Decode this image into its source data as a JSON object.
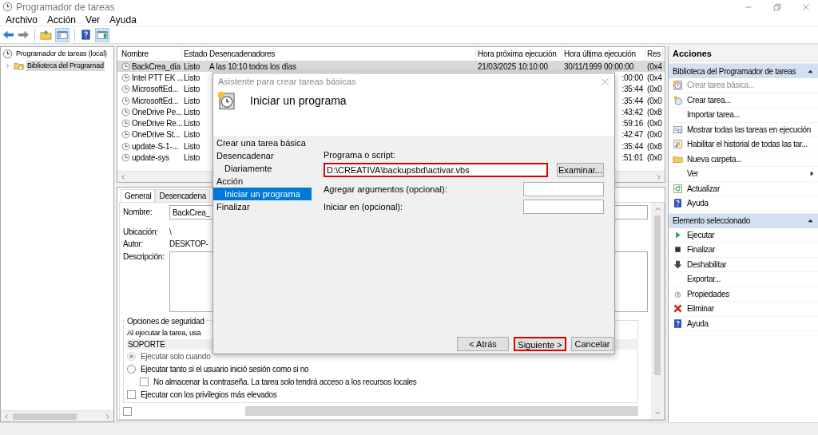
{
  "window": {
    "title": "Programador de tareas"
  },
  "menu": [
    "Archivo",
    "Acción",
    "Ver",
    "Ayuda"
  ],
  "toolbar": {
    "tree_pane_on": true,
    "action_pane_on": true
  },
  "tree": [
    {
      "label": "Programador de tareas (local)",
      "selected": false,
      "children": [
        {
          "label": "Biblioteca del Programad",
          "selected": true,
          "expanded": false
        }
      ]
    }
  ],
  "task_list": {
    "columns": [
      "Nombre",
      "Estado",
      "Desencadenadores",
      "Hora próxima ejecución",
      "Hora última ejecución",
      "Res"
    ],
    "rows": [
      {
        "name": "BackCrea_día",
        "status": "Listo",
        "trigger": "A las 10:10 todos los días",
        "next_run": "21/03/2025 10:10:00",
        "last_run": "30/11/1999 00:00:00",
        "result": "(0x4",
        "selected": true
      },
      {
        "name": "Intel PTT EK ...",
        "status": "Listo",
        "last_run": ":00:00",
        "result": "(0x4",
        "selected": false
      },
      {
        "name": "MicrosoftEd...",
        "status": "Listo",
        "last_run": ":35:44",
        "result": "(0x0",
        "selected": false
      },
      {
        "name": "MicrosoftEd...",
        "status": "Listo",
        "last_run": ":35:44",
        "result": "(0x0",
        "selected": false
      },
      {
        "name": "OneDrive Pe...",
        "status": "Listo",
        "last_run": ":43:42",
        "result": "(0x8",
        "selected": false
      },
      {
        "name": "OneDrive Re...",
        "status": "Listo",
        "last_run": ":59:16",
        "result": "(0x0",
        "selected": false
      },
      {
        "name": "OneDrive St...",
        "status": "Listo",
        "last_run": ":42:47",
        "result": "(0x0",
        "selected": false
      },
      {
        "name": "update-S-1-...",
        "status": "Listo",
        "last_run": ":35:44",
        "result": "(0x8",
        "selected": false
      },
      {
        "name": "update-sys",
        "status": "Listo",
        "last_run": ":51:01",
        "result": "(0x0",
        "selected": false
      }
    ]
  },
  "details": {
    "tabs": [
      {
        "label": "General",
        "selected": true
      },
      {
        "label": "Desencadena",
        "selected": false
      }
    ],
    "fields": [
      {
        "label": "Nombre:",
        "value": "BackCrea_",
        "kind": "input"
      },
      {
        "label": "Ubicación:",
        "value": "\\",
        "kind": "text"
      },
      {
        "label": "Autor:",
        "value": "DESKTOP-",
        "kind": "text"
      },
      {
        "label": "Descripción:",
        "kind": "textarea"
      }
    ],
    "security": {
      "title": "Opciones de seguridad",
      "prompt": "Al ejecutar la tarea, usa",
      "user": "SOPORTE",
      "options": [
        {
          "kind": "radio",
          "label": "Ejecutar solo cuando",
          "checked": true,
          "disabled": true
        },
        {
          "kind": "radio",
          "label": "Ejecutar tanto si el usuario inició sesión como si no",
          "checked": false,
          "disabled": false,
          "children": [
            {
              "kind": "checkbox",
              "label": "No almacenar la contraseña. La tarea solo tendrá acceso a los recursos locales",
              "checked": false,
              "disabled": false
            }
          ]
        },
        {
          "kind": "checkbox",
          "label": "Ejecutar con los privilegios más elevados",
          "checked": false,
          "disabled": false
        }
      ]
    },
    "bottom_row": {
      "checked": false
    }
  },
  "dialog": {
    "title": "Asistente para crear tareas básicas",
    "heading": "Iniciar un programa",
    "steps": [
      {
        "label": "Crear una tarea básica",
        "selected": false
      },
      {
        "label": "Desencadenar",
        "selected": false,
        "children": [
          {
            "label": "Diariamente",
            "selected": false
          }
        ]
      },
      {
        "label": "Acción",
        "selected": false,
        "children": [
          {
            "label": "Iniciar un programa",
            "selected": true
          }
        ]
      },
      {
        "label": "Finalizar",
        "selected": false
      }
    ],
    "fields": [
      {
        "label": "Programa o script:",
        "value": "D:\\CREATIVA\\backupsbd\\activar.vbs",
        "highlighted": true,
        "button": "Examinar..."
      },
      {
        "label": "Agregar argumentos (opcional):",
        "highlighted": false
      },
      {
        "label": "Iniciar en (opcional):",
        "highlighted": false
      }
    ],
    "buttons": [
      {
        "label": "< Atrás",
        "highlighted": false
      },
      {
        "label": "Siguiente >",
        "highlighted": true
      },
      {
        "label": "Cancelar",
        "highlighted": false
      }
    ]
  },
  "actions": {
    "title": "Acciones",
    "sections": [
      {
        "title": "Biblioteca del Programador de tareas",
        "expanded": true,
        "items": [
          {
            "label": "Crear tarea básica...",
            "disabled": true,
            "submenu": false
          },
          {
            "label": "Crear tarea...",
            "disabled": false,
            "submenu": false
          },
          {
            "label": "Importar tarea...",
            "disabled": false,
            "submenu": false
          },
          {
            "label": "Mostrar todas las tareas en ejecución",
            "disabled": false,
            "submenu": false
          },
          {
            "label": "Habilitar el historial de todas las tar...",
            "disabled": false,
            "submenu": false
          },
          {
            "label": "Nueva carpeta...",
            "disabled": false,
            "submenu": false
          },
          {
            "label": "Ver",
            "disabled": false,
            "submenu": true
          },
          {
            "label": "Actualizar",
            "disabled": false,
            "submenu": false
          },
          {
            "label": "Ayuda",
            "disabled": false,
            "submenu": false
          }
        ]
      },
      {
        "title": "Elemento seleccionado",
        "expanded": true,
        "items": [
          {
            "label": "Ejecutar",
            "disabled": false,
            "submenu": false
          },
          {
            "label": "Finalizar",
            "disabled": false,
            "submenu": false
          },
          {
            "label": "Deshabilitar",
            "disabled": false,
            "submenu": false
          },
          {
            "label": "Exportar...",
            "disabled": false,
            "submenu": false
          },
          {
            "label": "Propiedades",
            "disabled": false,
            "submenu": false
          },
          {
            "label": "Eliminar",
            "disabled": false,
            "submenu": false
          },
          {
            "label": "Ayuda",
            "disabled": false,
            "submenu": false
          }
        ]
      }
    ]
  }
}
